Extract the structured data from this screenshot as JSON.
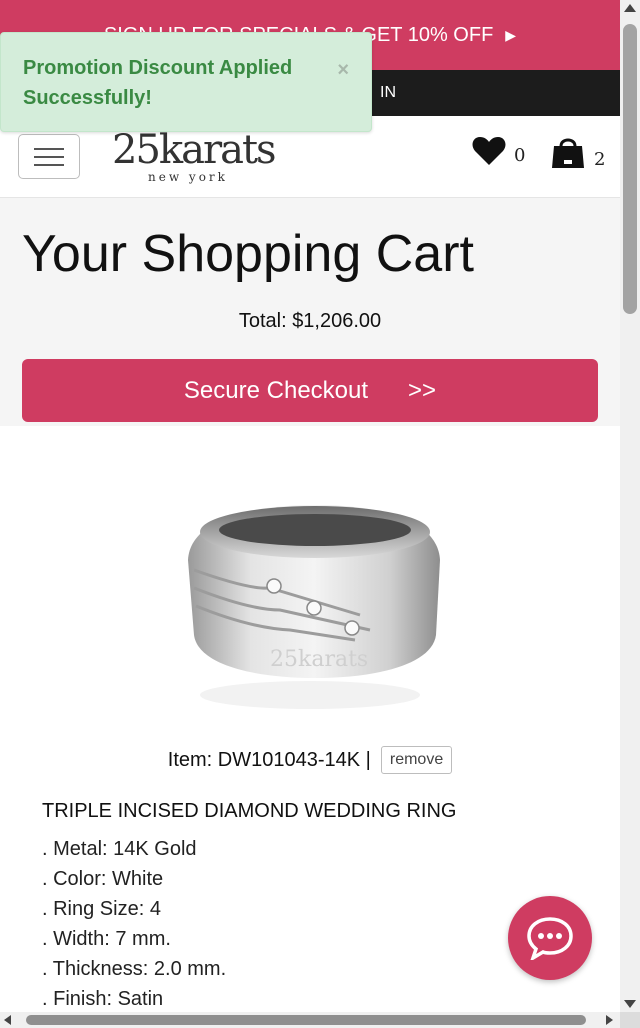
{
  "promo_bar": {
    "text": "SIGN UP FOR SPECIALS & GET 10% OFF",
    "arrow": "▶"
  },
  "account_bar": {
    "text": "IN"
  },
  "toast": {
    "message": "Promotion Discount Applied Successfully!",
    "close": "×"
  },
  "header": {
    "logo_main": "25karats",
    "logo_sub": "new york",
    "wishlist_count": "0",
    "cart_count": "2"
  },
  "cart": {
    "title": "Your Shopping Cart",
    "total": "Total: $1,206.00",
    "checkout_label": "Secure Checkout",
    "checkout_arrow": ">>"
  },
  "item": {
    "watermark": "25karats",
    "item_label": "Item: DW101043-14K |",
    "remove_label": "remove",
    "name": "TRIPLE INCISED DIAMOND WEDDING RING",
    "specs": [
      ". Metal: 14K Gold",
      ". Color: White",
      ". Ring Size: 4",
      ". Width: 7 mm.",
      ". Thickness: 2.0 mm.",
      ". Finish: Satin"
    ]
  },
  "colors": {
    "brand_pink": "#cf3c61",
    "toast_bg": "#d4edda",
    "toast_text": "#3a8a43",
    "dark_bar": "#1c1c1c"
  },
  "icons": {
    "menu": "hamburger-icon",
    "wishlist": "heart-icon",
    "cart": "shopping-bag-icon",
    "chat": "chat-bubble-icon"
  }
}
